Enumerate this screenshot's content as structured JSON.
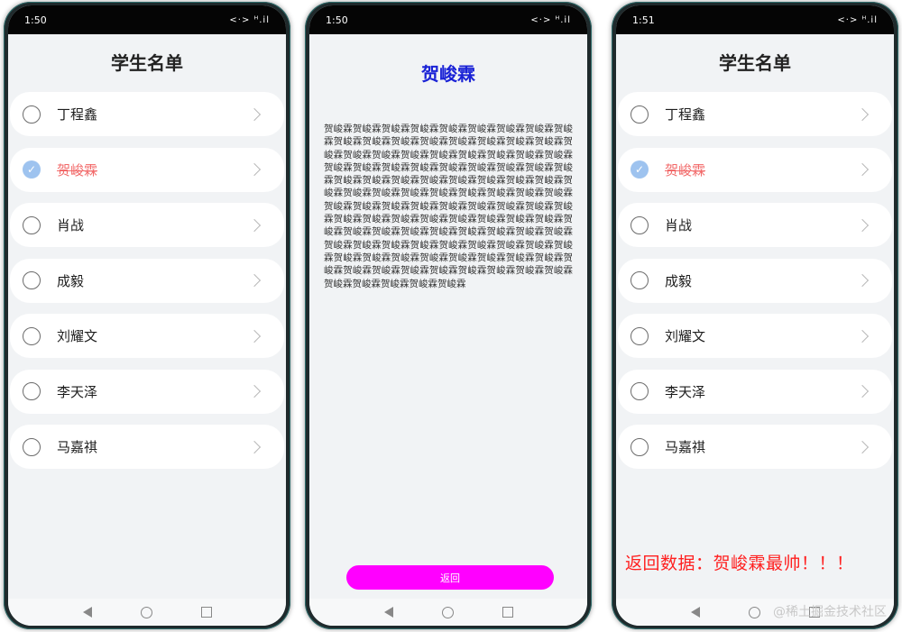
{
  "screen1": {
    "time": "1:50",
    "status_icons": "<·> ᴴ.il",
    "title": "学生名单",
    "students": [
      {
        "name": "丁程鑫",
        "selected": false
      },
      {
        "name": "贺峻霖",
        "selected": true
      },
      {
        "name": "肖战",
        "selected": false
      },
      {
        "name": "成毅",
        "selected": false
      },
      {
        "name": "刘耀文",
        "selected": false
      },
      {
        "name": "李天泽",
        "selected": false
      },
      {
        "name": "马嘉祺",
        "selected": false
      }
    ]
  },
  "screen2": {
    "time": "1:50",
    "status_icons": "<·> ᴴ.il",
    "title": "贺峻霖",
    "body": "贺峻霖贺峻霖贺峻霖贺峻霖贺峻霖贺峻霖贺峻霖贺峻霖贺峻霖贺峻霖贺峻霖贺峻霖贺峻霖贺峻霖贺峻霖贺峻霖贺峻霖贺峻霖贺峻霖贺峻霖贺峻霖贺峻霖贺峻霖贺峻霖贺峻霖贺峻霖贺峻霖贺峻霖贺峻霖贺峻霖贺峻霖贺峻霖贺峻霖贺峻霖贺峻霖贺峻霖贺峻霖贺峻霖贺峻霖贺峻霖贺峻霖贺峻霖贺峻霖贺峻霖贺峻霖贺峻霖贺峻霖贺峻霖贺峻霖贺峻霖贺峻霖贺峻霖贺峻霖贺峻霖贺峻霖贺峻霖贺峻霖贺峻霖贺峻霖贺峻霖贺峻霖贺峻霖贺峻霖贺峻霖贺峻霖贺峻霖贺峻霖贺峻霖贺峻霖贺峻霖贺峻霖贺峻霖贺峻霖贺峻霖贺峻霖贺峻霖贺峻霖贺峻霖贺峻霖贺峻霖贺峻霖贺峻霖贺峻霖贺峻霖贺峻霖贺峻霖贺峻霖贺峻霖贺峻霖贺峻霖贺峻霖贺峻霖贺峻霖贺峻霖贺峻霖贺峻霖贺峻霖贺峻霖贺峻霖贺峻霖贺峻霖贺峻霖贺峻霖贺峻霖贺峻霖贺峻霖贺峻霖贺峻霖贺峻霖",
    "button_label": "返回"
  },
  "screen3": {
    "time": "1:51",
    "status_icons": "<·> ᴴ.il",
    "title": "学生名单",
    "students": [
      {
        "name": "丁程鑫",
        "selected": false
      },
      {
        "name": "贺峻霖",
        "selected": true
      },
      {
        "name": "肖战",
        "selected": false
      },
      {
        "name": "成毅",
        "selected": false
      },
      {
        "name": "刘耀文",
        "selected": false
      },
      {
        "name": "李天泽",
        "selected": false
      },
      {
        "name": "马嘉祺",
        "selected": false
      }
    ],
    "return_message": "返回数据：贺峻霖最帅！！！"
  },
  "watermark": "@稀土掘金技术社区",
  "colors": {
    "detail_title": "#1a22d6",
    "button_bg": "#ff00ff",
    "selected_text": "#f26a6a",
    "return_text": "#ff2020"
  }
}
